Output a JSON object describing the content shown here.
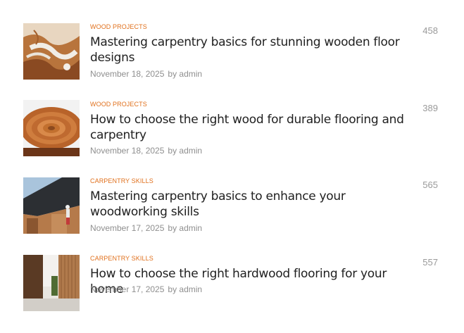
{
  "posts": [
    {
      "category": "WOOD PROJECTS",
      "title": "Mastering carpentry basics for stunning wooden floor designs",
      "date": "November 18, 2025",
      "author": "by admin",
      "count": "458",
      "thumbnail": "epoxy-river-table-image"
    },
    {
      "category": "WOOD PROJECTS",
      "title": "How to choose the right wood for durable flooring and carpentry",
      "date": "November 18, 2025",
      "author": "by admin",
      "count": "389",
      "thumbnail": "wood-slab-rings-image"
    },
    {
      "category": "CARPENTRY SKILLS",
      "title": "Mastering carpentry basics to enhance your woodworking skills",
      "date": "November 17, 2025",
      "author": "by admin",
      "count": "565",
      "thumbnail": "roofers-on-house-image"
    },
    {
      "category": "CARPENTRY SKILLS",
      "title": "How to choose the right hardwood flooring for your home",
      "date": "November 17, 2025",
      "author": "by admin",
      "count": "557",
      "thumbnail": "wood-slat-entrance-image"
    }
  ],
  "colors": {
    "category": "#e0701c",
    "title": "#1f1f1f",
    "meta": "#8f8f8f",
    "count": "#9a9a9a"
  }
}
